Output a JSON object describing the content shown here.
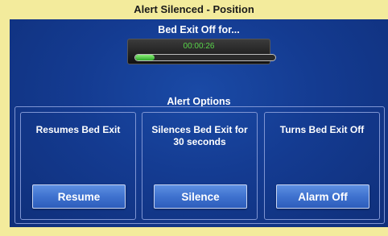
{
  "window": {
    "title": "Alert Silenced - Position"
  },
  "timer": {
    "label": "Bed Exit Off for...",
    "value": "00:00:26",
    "progress": 0.14
  },
  "alert_options": {
    "heading": "Alert Options",
    "options": [
      {
        "description": "Resumes Bed Exit",
        "button_label": "Resume"
      },
      {
        "description": "Silences Bed Exit for 30 seconds",
        "button_label": "Silence"
      },
      {
        "description": "Turns Bed Exit Off",
        "button_label": "Alarm Off"
      }
    ]
  },
  "colors": {
    "frame": "#f3eb9c",
    "panel": "#143b91",
    "timer_text": "#59d64a",
    "button": "#3f72cf"
  }
}
